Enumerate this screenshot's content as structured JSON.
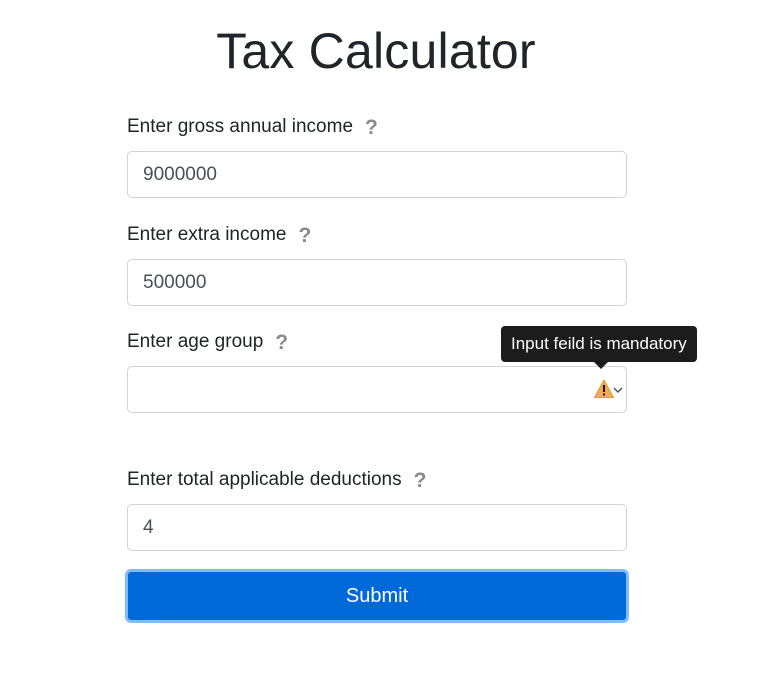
{
  "title": "Tax Calculator",
  "fields": {
    "gross_income": {
      "label": "Enter gross annual income",
      "value": "9000000"
    },
    "extra_income": {
      "label": "Enter extra income",
      "value": "500000"
    },
    "age_group": {
      "label": "Enter age group",
      "value": ""
    },
    "deductions": {
      "label": "Enter total applicable deductions",
      "value": "4"
    }
  },
  "help_glyph": "?",
  "tooltip": {
    "text": "Input feild is mandatory"
  },
  "submit_label": "Submit",
  "colors": {
    "primary": "#0069d9",
    "focus_ring": "#80bdff",
    "warning": "#f0ad4e",
    "tooltip_bg": "#1c1c1c"
  },
  "icons": {
    "help": "question-mark-icon",
    "warning": "warning-triangle-icon",
    "dropdown": "chevron-down-icon"
  }
}
